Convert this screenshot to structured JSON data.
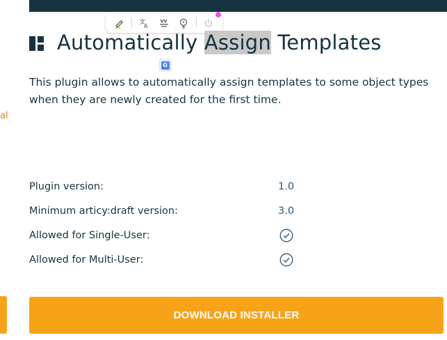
{
  "left_edge": {
    "cut_text": "al"
  },
  "toolbar": {
    "icons": [
      "highlighter-icon",
      "translate-icon",
      "summarize-icon",
      "lightbulb-icon",
      "power-icon"
    ]
  },
  "page": {
    "title_before": "Automatically ",
    "title_highlight": "Assign",
    "title_after": " Templates",
    "description": "This plugin allows to automatically assign templates to some object types when they are newly created for the first time."
  },
  "info": {
    "rows": [
      {
        "label": "Plugin version:",
        "value": "1.0"
      },
      {
        "label": "Minimum articy:draft version:",
        "value": "3.0"
      },
      {
        "label": "Allowed for Single-User:",
        "value": true
      },
      {
        "label": "Allowed for Multi-User:",
        "value": true
      }
    ]
  },
  "download": {
    "label": "DOWNLOAD INSTALLER"
  },
  "colors": {
    "accent": "#f7a31a",
    "heading": "#17323f",
    "value": "#2b5778"
  }
}
